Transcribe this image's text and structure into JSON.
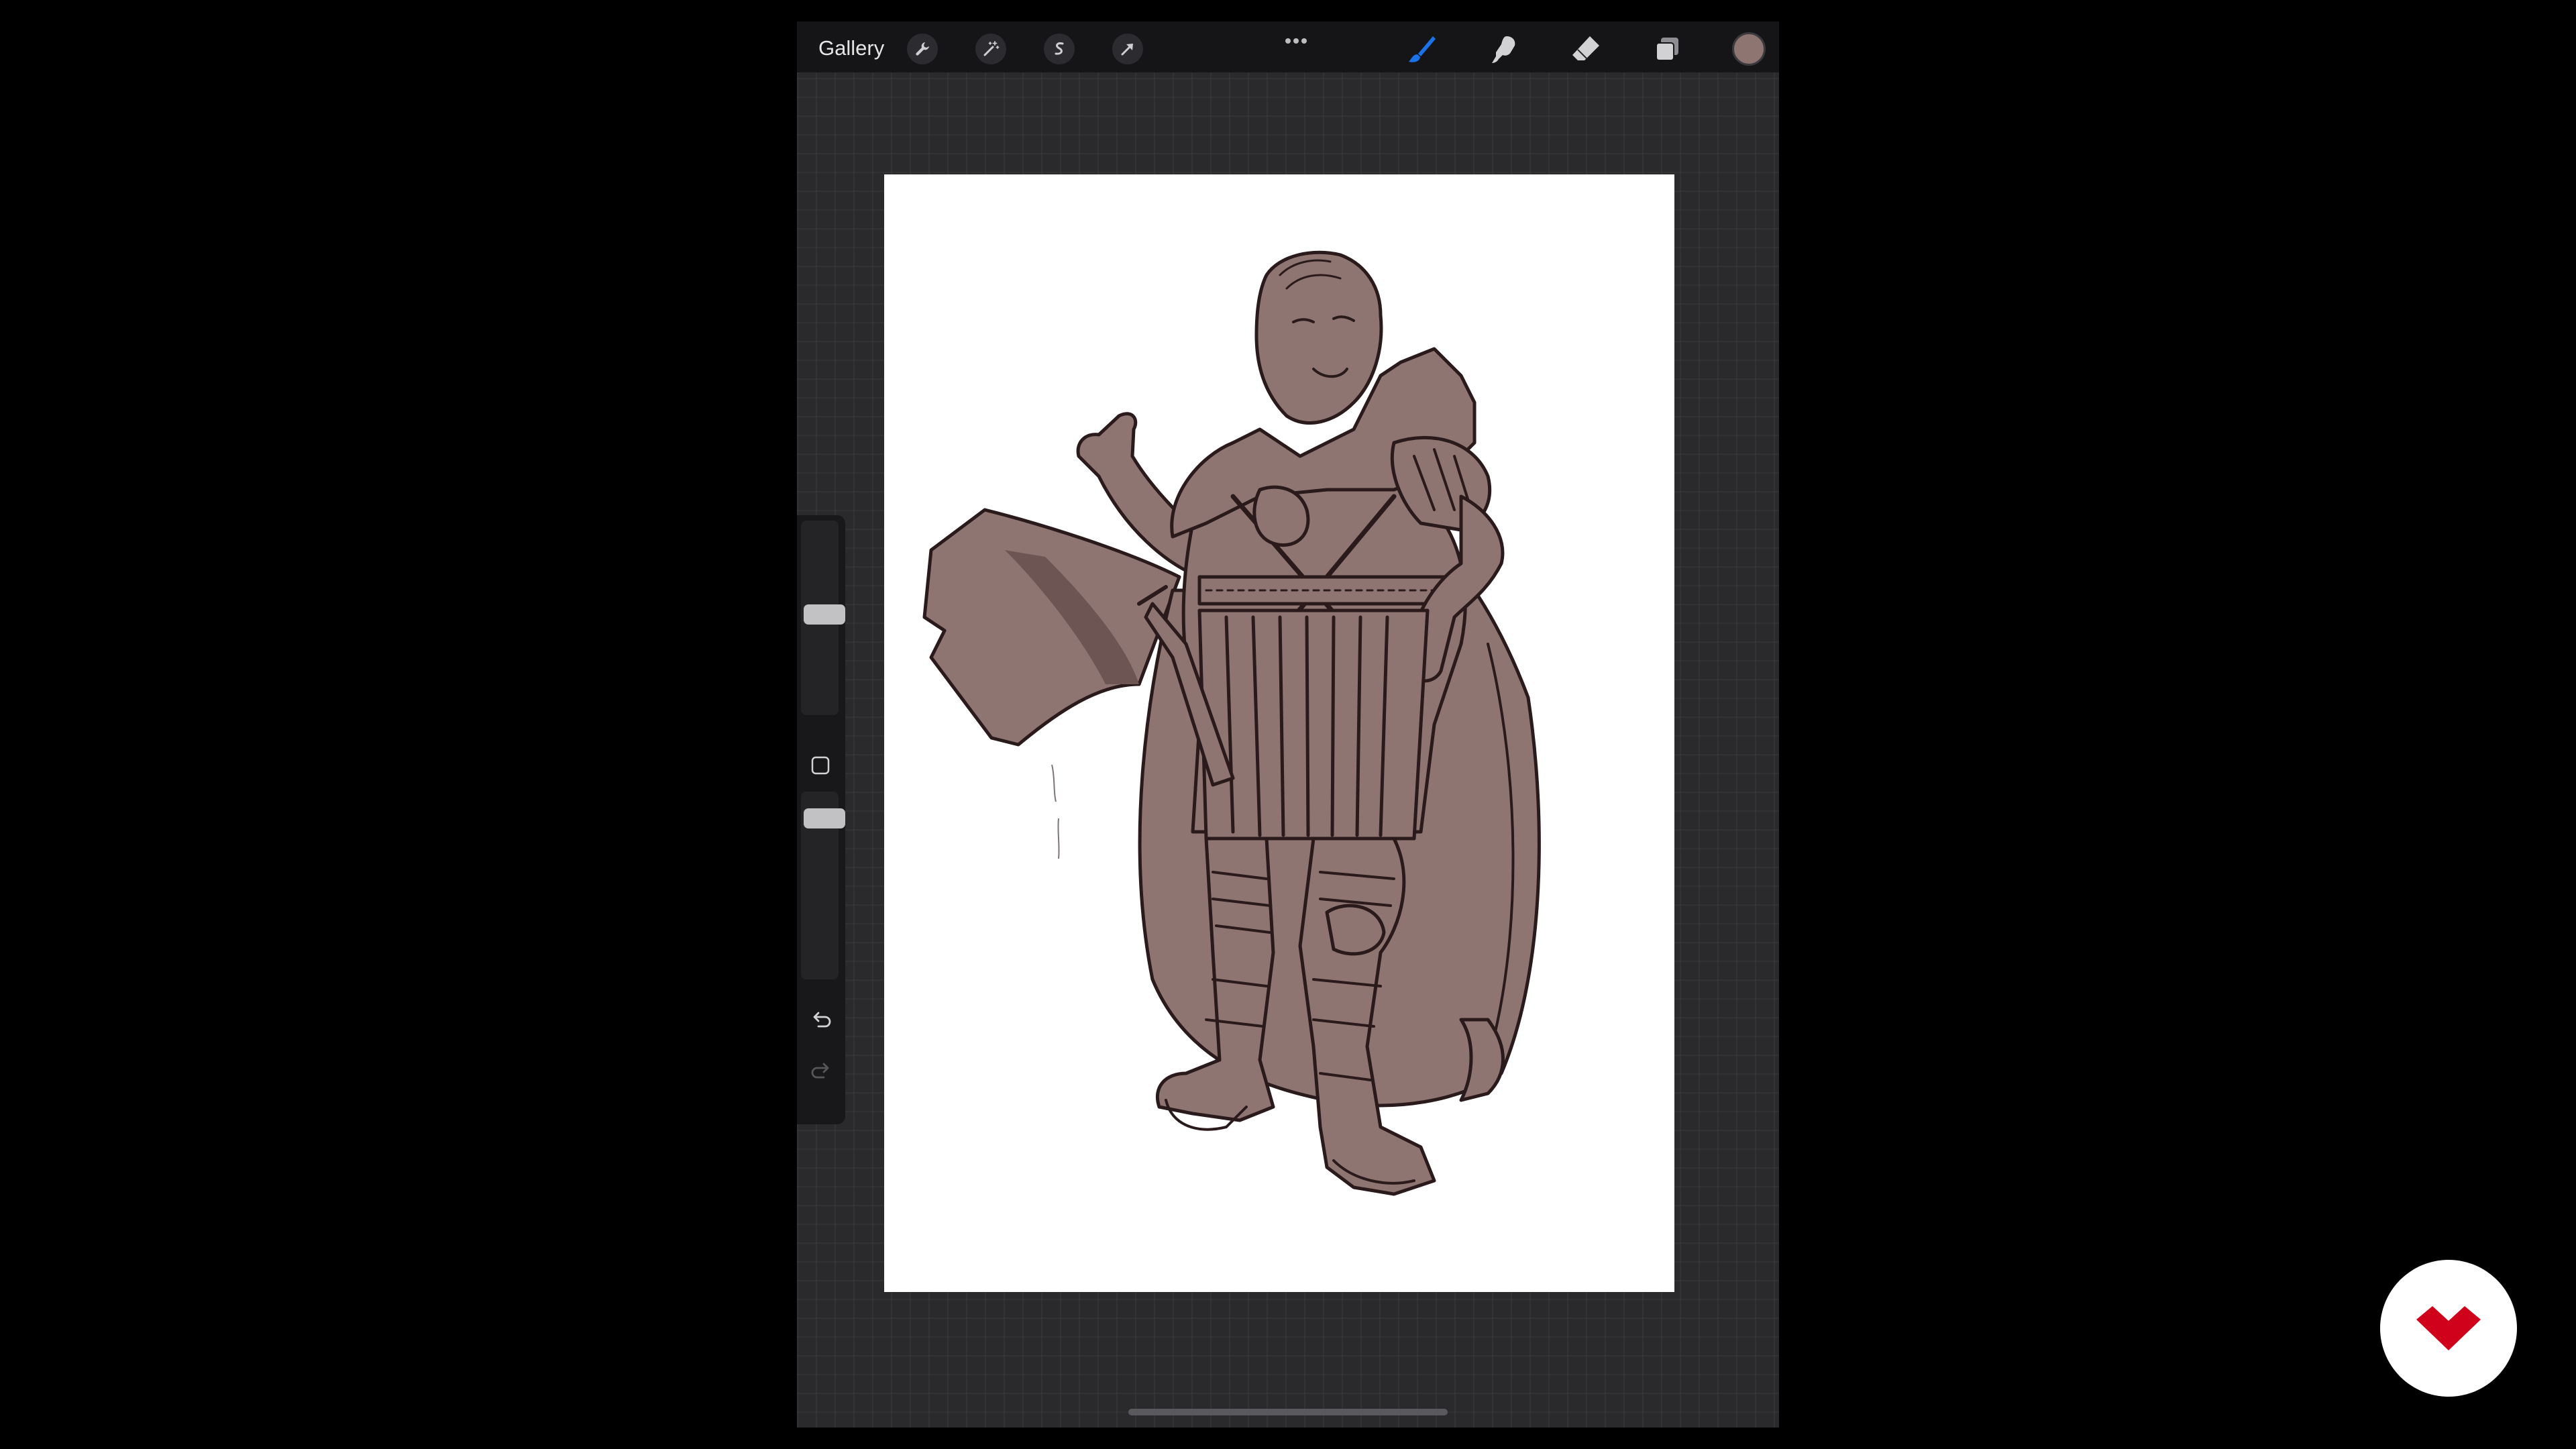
{
  "topbar": {
    "gallery_label": "Gallery",
    "left_tools": [
      "wrench-icon",
      "magic-wand-icon",
      "selection-icon",
      "transform-arrow-icon"
    ],
    "more_icon": "ellipsis-icon",
    "right_tools": [
      "brush-icon",
      "smudge-icon",
      "eraser-icon",
      "layers-icon"
    ],
    "active_tool": "brush",
    "current_color": "#8e7571"
  },
  "sidebar": {
    "brush_size": 0.52,
    "opacity": 0.9,
    "modify_icon": "square-modify-icon",
    "undo_icon": "undo-icon",
    "redo_icon": "redo-icon"
  },
  "colors": {
    "accent": "#1a73e8",
    "line": "#2a1a1c",
    "fill": "#8e7571",
    "shadow": "#6d5553",
    "logo": "#d0021b"
  }
}
